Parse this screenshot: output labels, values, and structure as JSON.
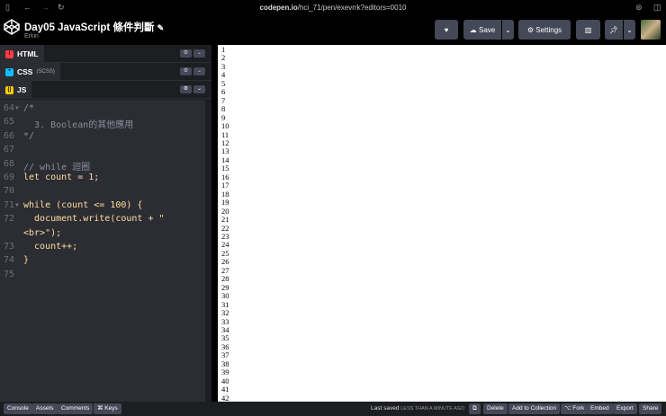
{
  "browser": {
    "url_host": "codepen.io",
    "url_path": "/hci_71/pen/exevrrk?editors=0010"
  },
  "header": {
    "title": "Day05 JavaScript 條件判斷",
    "author": "Erkin",
    "save": "Save",
    "settings": "Settings"
  },
  "tabs": [
    {
      "label": "HTML",
      "sub": "",
      "color": "#ff3c41",
      "glyph": "/"
    },
    {
      "label": "CSS",
      "sub": "(SCSS)",
      "color": "#0ebeff",
      "glyph": "*"
    },
    {
      "label": "JS",
      "sub": "",
      "color": "#fcd000",
      "glyph": "()"
    }
  ],
  "code": [
    {
      "n": "64",
      "t": "/*"
    },
    {
      "n": "65",
      "t": "  3. Boolean的其他應用"
    },
    {
      "n": "66",
      "t": "*/"
    },
    {
      "n": "67",
      "t": ""
    },
    {
      "n": "68",
      "t": "// while 迴圈"
    },
    {
      "n": "69",
      "t": "let count = 1;"
    },
    {
      "n": "70",
      "t": ""
    },
    {
      "n": "71",
      "t": "while (count <= 100) {"
    },
    {
      "n": "72",
      "t": "  document.write(count + \""
    },
    {
      "n": "",
      "t": "<br>\");"
    },
    {
      "n": "73",
      "t": "  count++;"
    },
    {
      "n": "74",
      "t": "}"
    },
    {
      "n": "75",
      "t": ""
    }
  ],
  "preview_count": 42,
  "footer": {
    "left": [
      "Console",
      "Assets",
      "Comments",
      "⌘ Keys"
    ],
    "saved": "Last saved",
    "saved_when": "LESS THAN A MINUTE AGO",
    "right": [
      "Delete",
      "Add to Collection",
      "⌥ Fork",
      "Embed",
      "Export",
      "Share"
    ]
  }
}
